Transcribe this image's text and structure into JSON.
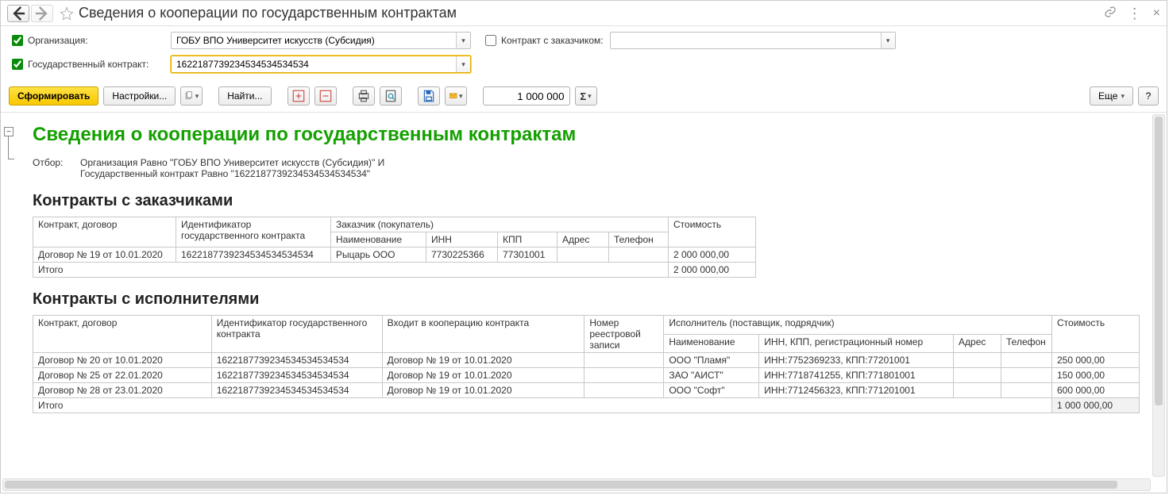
{
  "window": {
    "title": "Сведения о кооперации по государственным контрактам"
  },
  "filters": {
    "org_checked": true,
    "org_label": "Организация:",
    "org_value": "ГОБУ ВПО Университет искусств (Субсидия)",
    "customer_checked": false,
    "customer_label": "Контракт с заказчиком:",
    "customer_value": "",
    "gov_checked": true,
    "gov_label": "Государственный контракт:",
    "gov_value": "1622187739234534534534534"
  },
  "toolbar": {
    "generate": "Сформировать",
    "settings": "Настройки...",
    "find": "Найти...",
    "number_value": "1 000 000",
    "more": "Еще",
    "help": "?"
  },
  "report": {
    "title": "Сведения о кооперации по государственным контрактам",
    "selection_label": "Отбор:",
    "selection_lines": [
      "Организация Равно \"ГОБУ ВПО Университет искусств (Субсидия)\" И",
      "Государственный контракт Равно \"1622187739234534534534534\""
    ],
    "sec1_title": "Контракты с заказчиками",
    "sec1_headers": {
      "contract": "Контракт, договор",
      "ident": "Идентификатор государственного контракта",
      "customer": "Заказчик (покупатель)",
      "name": "Наименование",
      "inn": "ИНН",
      "kpp": "КПП",
      "addr": "Адрес",
      "phone": "Телефон",
      "cost": "Стоимость"
    },
    "sec1_rows": [
      {
        "contract": "Договор № 19 от 10.01.2020",
        "ident": "1622187739234534534534534",
        "name": "Рыцарь ООО",
        "inn": "7730225366",
        "kpp": "77301001",
        "addr": "",
        "phone": "",
        "cost": "2 000 000,00"
      }
    ],
    "sec1_total_label": "Итого",
    "sec1_total_value": "2 000 000,00",
    "sec2_title": "Контракты с исполнителями",
    "sec2_headers": {
      "contract": "Контракт, договор",
      "ident": "Идентификатор государственного контракта",
      "enters": "Входит в кооперацию контракта",
      "reg_no": "Номер реестровой записи",
      "executor": "Исполнитель (поставщик, подрядчик)",
      "name": "Наименование",
      "inn_kpp": "ИНН, КПП, регистрационный номер",
      "addr": "Адрес",
      "phone": "Телефон",
      "cost": "Стоимость"
    },
    "sec2_rows": [
      {
        "contract": "Договор № 20 от 10.01.2020",
        "ident": "1622187739234534534534534",
        "enters": "Договор № 19 от 10.01.2020",
        "reg": "",
        "name": "ООО \"Пламя\"",
        "inn_kpp": "ИНН:7752369233, КПП:77201001",
        "addr": "",
        "phone": "",
        "cost": "250 000,00"
      },
      {
        "contract": "Договор № 25 от 22.01.2020",
        "ident": "1622187739234534534534534",
        "enters": "Договор № 19 от 10.01.2020",
        "reg": "",
        "name": "ЗАО \"АИСТ\"",
        "inn_kpp": "ИНН:7718741255, КПП:771801001",
        "addr": "",
        "phone": "",
        "cost": "150 000,00"
      },
      {
        "contract": "Договор № 28 от 23.01.2020",
        "ident": "1622187739234534534534534",
        "enters": "Договор № 19 от 10.01.2020",
        "reg": "",
        "name": "ООО \"Софт\"",
        "inn_kpp": "ИНН:7712456323, КПП:771201001",
        "addr": "",
        "phone": "",
        "cost": "600 000,00"
      }
    ],
    "sec2_total_label": "Итого",
    "sec2_total_value": "1 000 000,00"
  }
}
